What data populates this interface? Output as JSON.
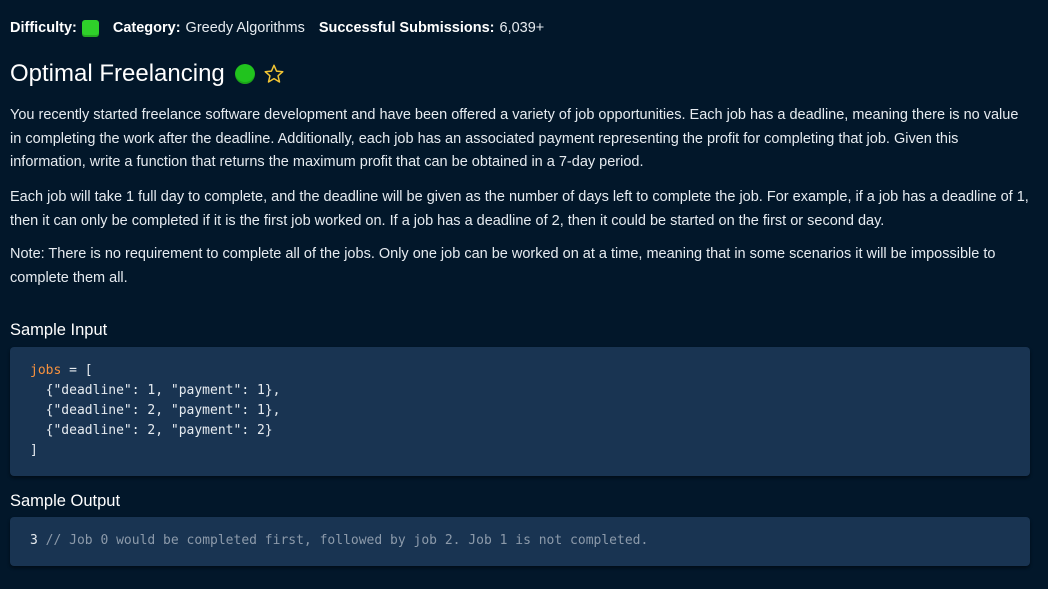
{
  "meta": {
    "difficulty_label": "Difficulty:",
    "difficulty_color": "#2fd02a",
    "category_label": "Category:",
    "category_value": "Greedy Algorithms",
    "submissions_label": "Successful Submissions:",
    "submissions_value": "6,039+"
  },
  "problem": {
    "title": "Optimal Freelancing",
    "status_color": "#21c31e",
    "favorite_icon": "star-outline-icon",
    "paragraphs": [
      "You recently started freelance software development and have been offered a variety of job opportunities. Each job has a deadline, meaning there is no value in completing the work after the deadline. Additionally, each job has an associated payment representing the profit for completing that job. Given this information, write a function that returns the maximum profit that can be obtained in a 7-day period.",
      "Each job will take 1 full day to complete, and the deadline will be given as the number of days left to complete the job. For example, if a job has a deadline of 1, then it can only be completed if it is the first job worked on. If a job has a deadline of 2, then it could be started on the first or second day.",
      "Note: There is no requirement to complete all of the jobs. Only one job can be worked on at a time, meaning that in some scenarios it will be impossible to complete them all."
    ]
  },
  "sample_input": {
    "title": "Sample Input",
    "var_name": "jobs",
    "assign": " = [",
    "lines": [
      "  {\"deadline\": 1, \"payment\": 1},",
      "  {\"deadline\": 2, \"payment\": 1},",
      "  {\"deadline\": 2, \"payment\": 2}",
      "]"
    ]
  },
  "sample_output": {
    "title": "Sample Output",
    "value": "3",
    "comment": " // Job 0 would be completed first, followed by job 2. Job 1 is not completed."
  },
  "colors": {
    "background": "#02172a",
    "code_background": "#193452",
    "variable": "#f8923e",
    "comment": "#8c9aaa"
  }
}
